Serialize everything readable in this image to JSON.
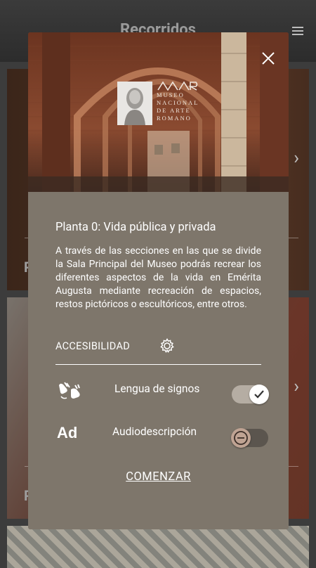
{
  "app": {
    "title": "Recorridos",
    "menu_icon": "hamburger-menu-icon"
  },
  "background_cards": [
    {
      "letter": "P",
      "chevron": "›"
    },
    {
      "letter": "P",
      "chevron": "›"
    }
  ],
  "dialog": {
    "logo": {
      "mar": "MAR",
      "lines": [
        "MUSEO",
        "NACIONAL",
        "DE ARTE",
        "ROMANO"
      ]
    },
    "close_icon": "close-icon",
    "route_title": "Planta 0: Vida pública y privada",
    "route_description": "A través de las secciones en las que se divide la Sala Principal del Museo podrás recrear los diferentes aspectos de la vida en Emérita Augusta mediante recreación de espacios, restos pictóricos o escultóricos, entre otros.",
    "accessibility_label": "ACCESIBILIDAD",
    "accessibility_icon": "gear-icon",
    "options": [
      {
        "label": "Lengua de signos",
        "icon": "sign-language-icon",
        "enabled": true
      },
      {
        "label": "Audiodescripción",
        "icon": "audio-description-icon",
        "icon_text": "Ad",
        "enabled": false
      }
    ],
    "start_label": "COMENZAR"
  },
  "colors": {
    "dialog_bg": "#7e766b",
    "toggle_on_track": "#b5ada3",
    "toggle_off_track": "#5b554e",
    "toggle_off_knob": "#bfa393"
  }
}
